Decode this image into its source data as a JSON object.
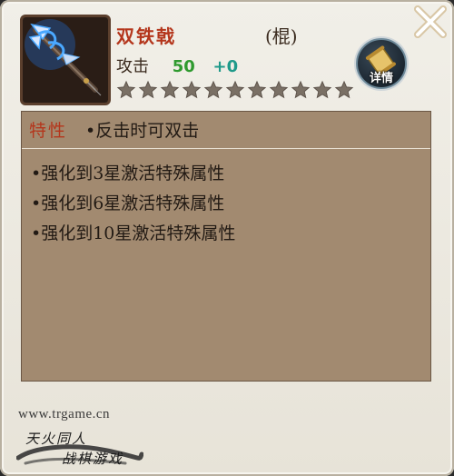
{
  "item": {
    "name": "双铁戟",
    "type": "(棍)",
    "attack_label": "攻击",
    "attack_value": "50",
    "attack_bonus": "+0",
    "stars_total": 11,
    "stars_filled": 0
  },
  "buttons": {
    "detail_label": "详情",
    "close_icon": "close-x-icon"
  },
  "trait": {
    "label": "特性",
    "text": "•反击时可双击"
  },
  "enhancements": [
    "•强化到3星激活特殊属性",
    "•强化到6星激活特殊属性",
    "•强化到10星激活特殊属性"
  ],
  "footer": {
    "website": "www.trgame.cn",
    "logo_line1": "天火同人",
    "logo_line2": "战棋游戏"
  },
  "colors": {
    "name": "#b4361c",
    "attack_value": "#2f9a2f",
    "attack_bonus": "#1f9a8a",
    "content_bg": "#a28a70"
  }
}
